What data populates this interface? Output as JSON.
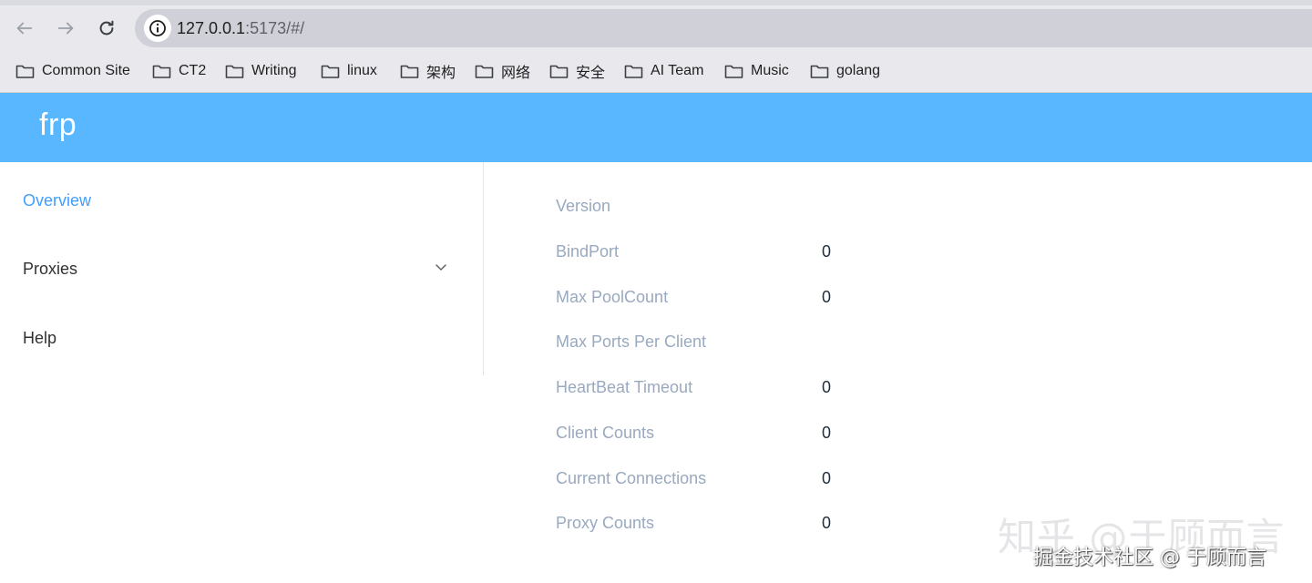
{
  "browser": {
    "url_host": "127.0.0.1",
    "url_path": ":5173/#/",
    "bookmarks": [
      {
        "label": "Common Site"
      },
      {
        "label": "CT2"
      },
      {
        "label": "Writing"
      },
      {
        "label": "linux"
      },
      {
        "label": "架构"
      },
      {
        "label": "网络"
      },
      {
        "label": "安全"
      },
      {
        "label": "AI Team"
      },
      {
        "label": "Music"
      },
      {
        "label": "golang"
      }
    ]
  },
  "app": {
    "brand": "frp",
    "header_color": "#58b7ff",
    "accent_color": "#409eff"
  },
  "sidebar": {
    "items": [
      {
        "label": "Overview",
        "active": true
      },
      {
        "label": "Proxies",
        "icon": "chevron-down-icon"
      },
      {
        "label": "Help"
      }
    ]
  },
  "overview": {
    "rows": [
      {
        "label": "Version",
        "value": ""
      },
      {
        "label": "BindPort",
        "value": "0"
      },
      {
        "label": "Max PoolCount",
        "value": "0"
      },
      {
        "label": "Max Ports Per Client",
        "value": ""
      },
      {
        "label": "HeartBeat Timeout",
        "value": "0"
      },
      {
        "label": "Client Counts",
        "value": "0"
      },
      {
        "label": "Current Connections",
        "value": "0"
      },
      {
        "label": "Proxy Counts",
        "value": "0"
      }
    ]
  },
  "watermark": {
    "line1": "知乎 @于顾而言",
    "line2": "掘金技术社区 @ 于顾而言"
  }
}
